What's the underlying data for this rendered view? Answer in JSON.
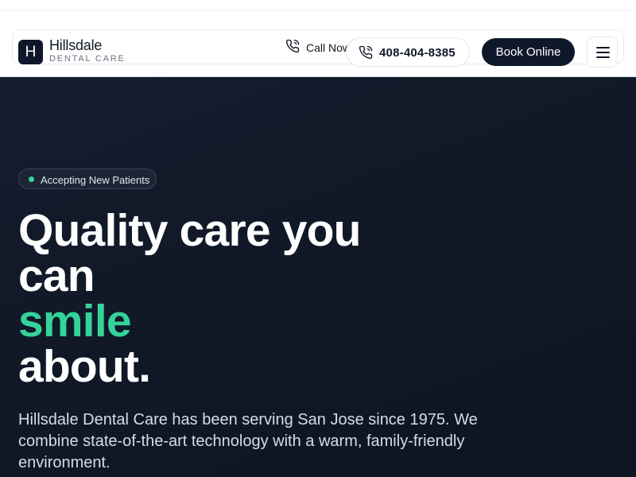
{
  "brand": {
    "logo_letter": "H",
    "name": "Hillsdale",
    "subtitle": "DENTAL CARE"
  },
  "nav": {
    "call_label": "Call Now",
    "phone_number": "408-404-8385",
    "book_label": "Book Online",
    "menu_icon": "hamburger-menu-icon",
    "phone_icon": "phone-icon"
  },
  "hero": {
    "badge_text": "Accepting New Patients",
    "headline_line1": "Quality care you",
    "headline_line2": "can",
    "headline_accent": "smile",
    "headline_line4": "about.",
    "lead": "Hillsdale Dental Care has been serving San Jose since 1975. We combine state-of-the-art technology with a warm, family-friendly environment."
  },
  "colors": {
    "navy": "#0f172a",
    "accent_green": "#34d399",
    "hero_background": "#111a2b"
  }
}
